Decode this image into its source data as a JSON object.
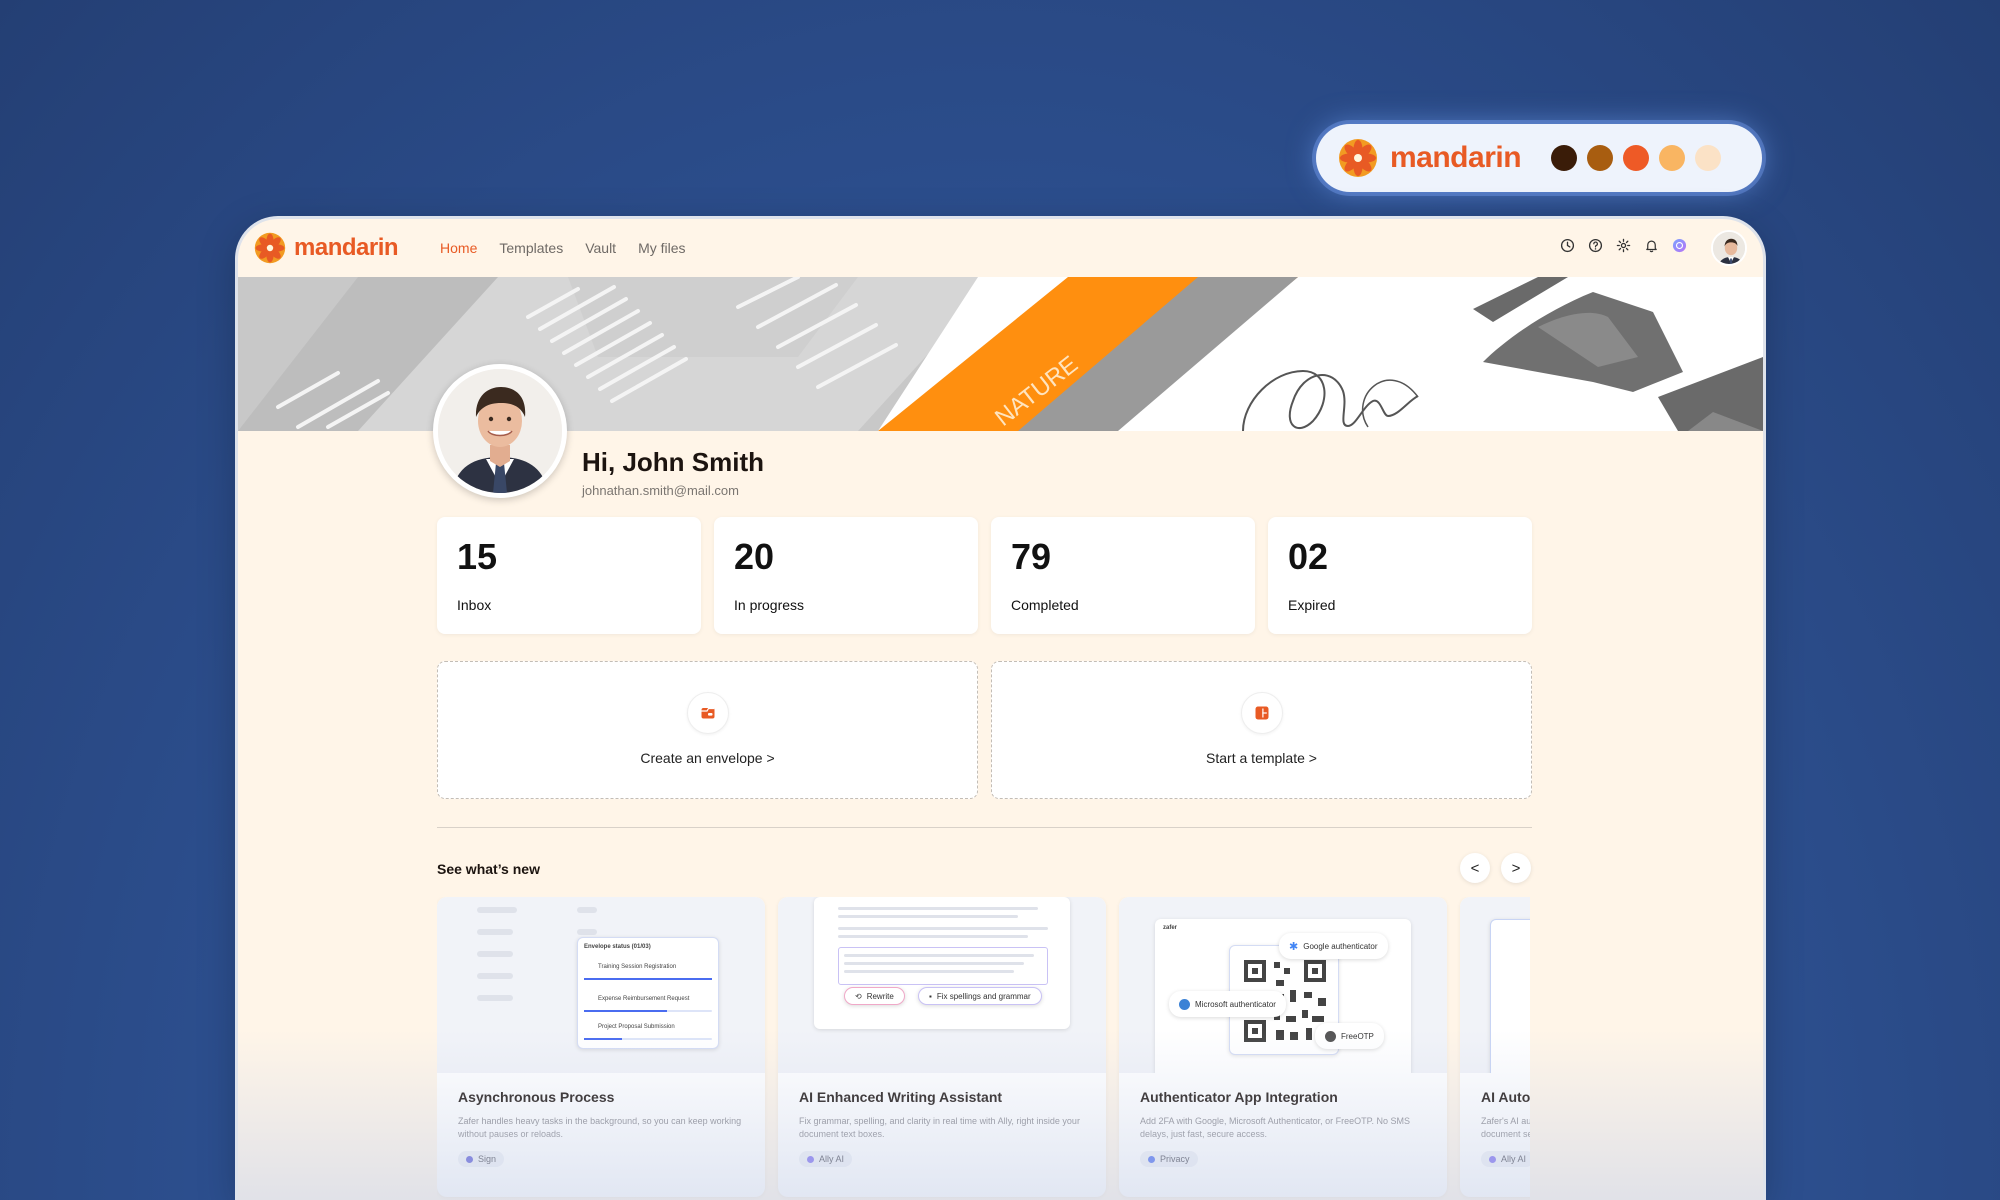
{
  "brand": {
    "name": "mandarin",
    "palette": [
      "#3a1c08",
      "#a85d10",
      "#ee5a26",
      "#f9b562",
      "#fbe2c6"
    ]
  },
  "colors": {
    "accent": "#e85a24",
    "window_bg": "#fff5e8"
  },
  "nav": {
    "links": [
      {
        "label": "Home",
        "active": true
      },
      {
        "label": "Templates",
        "active": false
      },
      {
        "label": "Vault",
        "active": false
      },
      {
        "label": "My files",
        "active": false
      }
    ],
    "icons": [
      "history-icon",
      "help-icon",
      "settings-icon",
      "bell-icon",
      "ai-assistant-icon"
    ]
  },
  "hero": {
    "banner_text": "NATURE"
  },
  "profile": {
    "greeting": "Hi, John Smith",
    "email": "johnathan.smith@mail.com"
  },
  "stats": [
    {
      "value": "15",
      "label": "Inbox"
    },
    {
      "value": "20",
      "label": "In progress"
    },
    {
      "value": "79",
      "label": "Completed"
    },
    {
      "value": "02",
      "label": "Expired"
    }
  ],
  "actions": [
    {
      "label": "Create an envelope >",
      "icon": "envelope-icon"
    },
    {
      "label": "Start a template >",
      "icon": "template-icon"
    }
  ],
  "whats_new": {
    "title": "See what’s new",
    "prev_label": "<",
    "next_label": ">",
    "cards": [
      {
        "title": "Asynchronous Process",
        "description": "Zafer handles heavy tasks in the background, so you can keep working without pauses or reloads.",
        "tag": "Sign",
        "tag_color": "#5b5bd6",
        "preview": {
          "panel_title": "Envelope status (01/03)",
          "items": [
            "Training Session Registration",
            "Expense Reimbursement Request",
            "Project Proposal Submission"
          ],
          "item_progress": [
            1.0,
            0.65,
            0.3
          ]
        }
      },
      {
        "title": "AI Enhanced Writing Assistant",
        "description": "Fix grammar, spelling, and clarity in real time with Ally, right inside your document text boxes.",
        "tag": "Ally AI",
        "tag_color": "#7b6cf0",
        "preview": {
          "button_rewrite": "Rewrite",
          "button_fix": "Fix spellings and grammar"
        }
      },
      {
        "title": "Authenticator App Integration",
        "description": "Add 2FA with Google, Microsoft Authenticator, or FreeOTP. No SMS delays, just fast, secure access.",
        "tag": "Privacy",
        "tag_color": "#4a6cf0",
        "preview": {
          "brand": "zafer",
          "google": "Google authenticator",
          "microsoft": "Microsoft authenticator",
          "freeotp": "FreeOTP"
        }
      },
      {
        "title": "AI Auto",
        "description": "Zafer's AI au document se",
        "tag": "Ally AI",
        "tag_color": "#7b6cf0"
      }
    ]
  }
}
